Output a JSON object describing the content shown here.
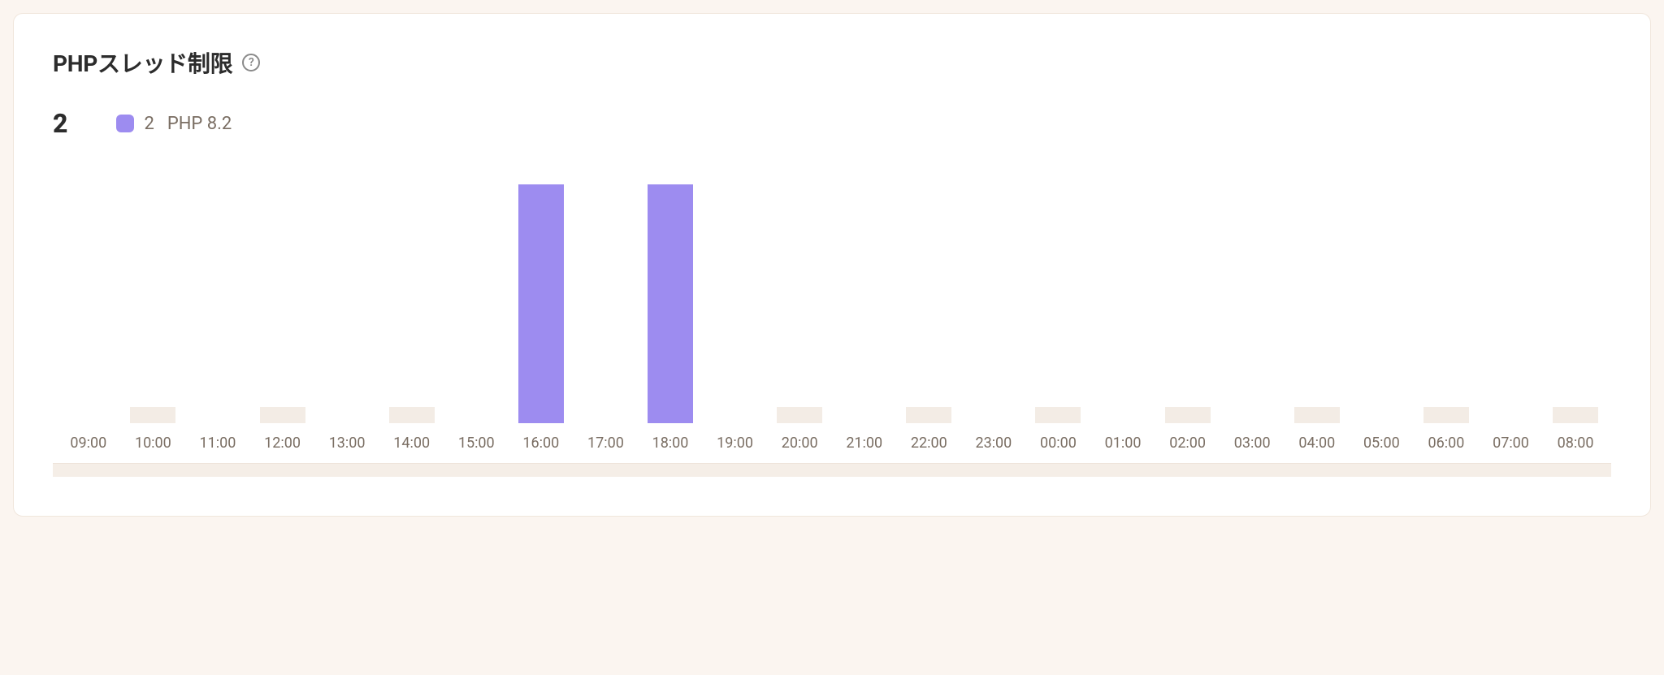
{
  "title": "PHPスレッド制限",
  "help_tooltip": "?",
  "summary": {
    "total": "2"
  },
  "legend": {
    "swatch_color": "#9d8cf0",
    "value": "2",
    "label": "PHP 8.2"
  },
  "chart_data": {
    "type": "bar",
    "title": "PHPスレッド制限",
    "xlabel": "",
    "ylabel": "",
    "ylim": [
      0,
      2
    ],
    "categories": [
      "09:00",
      "10:00",
      "11:00",
      "12:00",
      "13:00",
      "14:00",
      "15:00",
      "16:00",
      "17:00",
      "18:00",
      "19:00",
      "20:00",
      "21:00",
      "22:00",
      "23:00",
      "00:00",
      "01:00",
      "02:00",
      "03:00",
      "04:00",
      "05:00",
      "06:00",
      "07:00",
      "08:00"
    ],
    "series": [
      {
        "name": "PHP 8.2",
        "color": "#9d8cf0",
        "values": [
          0,
          0,
          0,
          0,
          0,
          0,
          0,
          2,
          0,
          2,
          0,
          0,
          0,
          0,
          0,
          0,
          0,
          0,
          0,
          0,
          0,
          0,
          0,
          0
        ]
      }
    ]
  }
}
